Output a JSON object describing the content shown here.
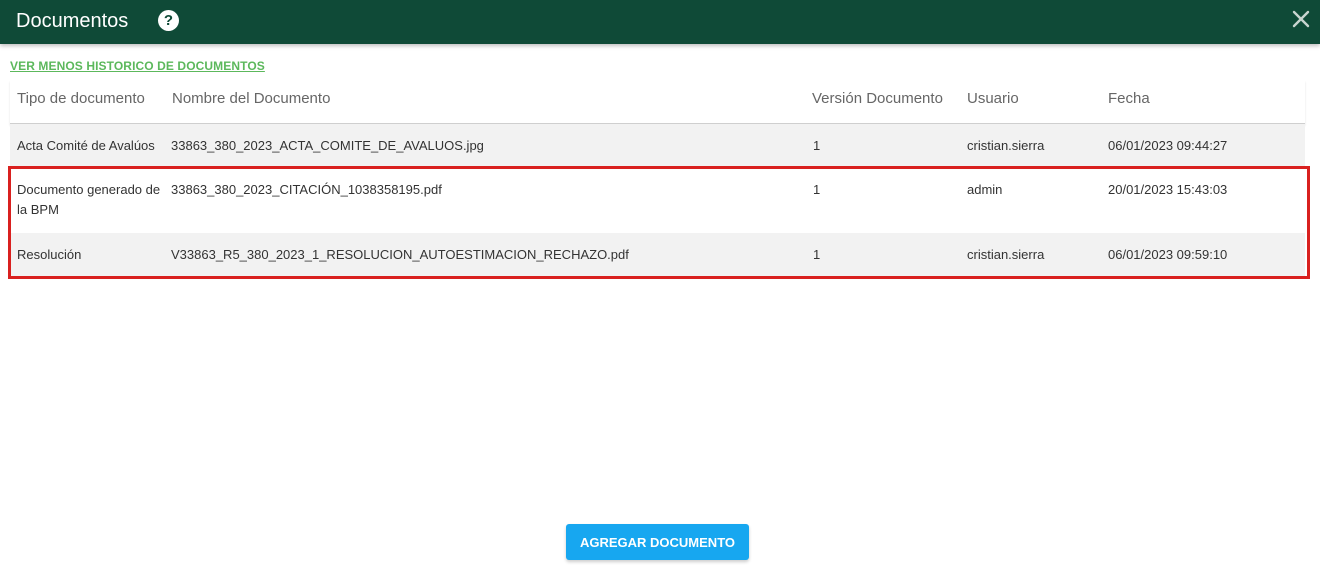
{
  "dialog": {
    "title": "Documentos",
    "help_icon_glyph": "?",
    "history_link": "VER MENOS HISTORICO DE DOCUMENTOS"
  },
  "table": {
    "headers": [
      "Tipo de documento",
      "Nombre del Documento",
      "Versión Documento",
      "Usuario",
      "Fecha"
    ],
    "rows": [
      [
        "Acta Comité de Avalúos",
        "33863_380_2023_ACTA_COMITE_DE_AVALUOS.jpg",
        "1",
        "cristian.sierra",
        "06/01/2023 09:44:27"
      ],
      [
        "Documento generado de la BPM",
        "33863_380_2023_CITACIÓN_1038358195.pdf",
        "1",
        "admin",
        "20/01/2023 15:43:03"
      ],
      [
        "Resolución",
        "V33863_R5_380_2023_1_RESOLUCION_AUTOESTIMACION_RECHAZO.pdf",
        "1",
        "cristian.sierra",
        "06/01/2023 09:59:10"
      ]
    ]
  },
  "actions": {
    "add_document": "AGREGAR DOCUMENTO"
  },
  "colors": {
    "header_bg": "#0f4a37",
    "link": "#5cb85c",
    "highlight": "#d9201f",
    "primary_button": "#17a7f0"
  },
  "icons": {
    "help": "question-circle-icon",
    "close": "close-icon"
  }
}
